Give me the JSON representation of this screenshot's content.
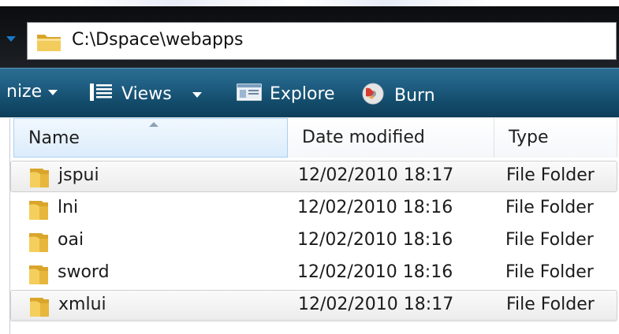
{
  "address": {
    "path": "C:\\Dspace\\webapps"
  },
  "toolbar": {
    "organize_label": "nize",
    "views_label": "Views",
    "explore_label": "Explore",
    "burn_label": "Burn"
  },
  "columns": {
    "name": "Name",
    "date": "Date modified",
    "type": "Type"
  },
  "rows": [
    {
      "name": "jspui",
      "date": "12/02/2010 18:17",
      "type": "File Folder",
      "highlight": true
    },
    {
      "name": "lni",
      "date": "12/02/2010 18:16",
      "type": "File Folder",
      "highlight": false
    },
    {
      "name": "oai",
      "date": "12/02/2010 18:16",
      "type": "File Folder",
      "highlight": false
    },
    {
      "name": "sword",
      "date": "12/02/2010 18:16",
      "type": "File Folder",
      "highlight": false
    },
    {
      "name": "xmlui",
      "date": "12/02/2010 18:17",
      "type": "File Folder",
      "highlight": true
    }
  ],
  "colors": {
    "toolbar_accent": "#1f5e82",
    "folder_yellow": "#e8b93a",
    "sorted_column": "#dcecfb"
  }
}
